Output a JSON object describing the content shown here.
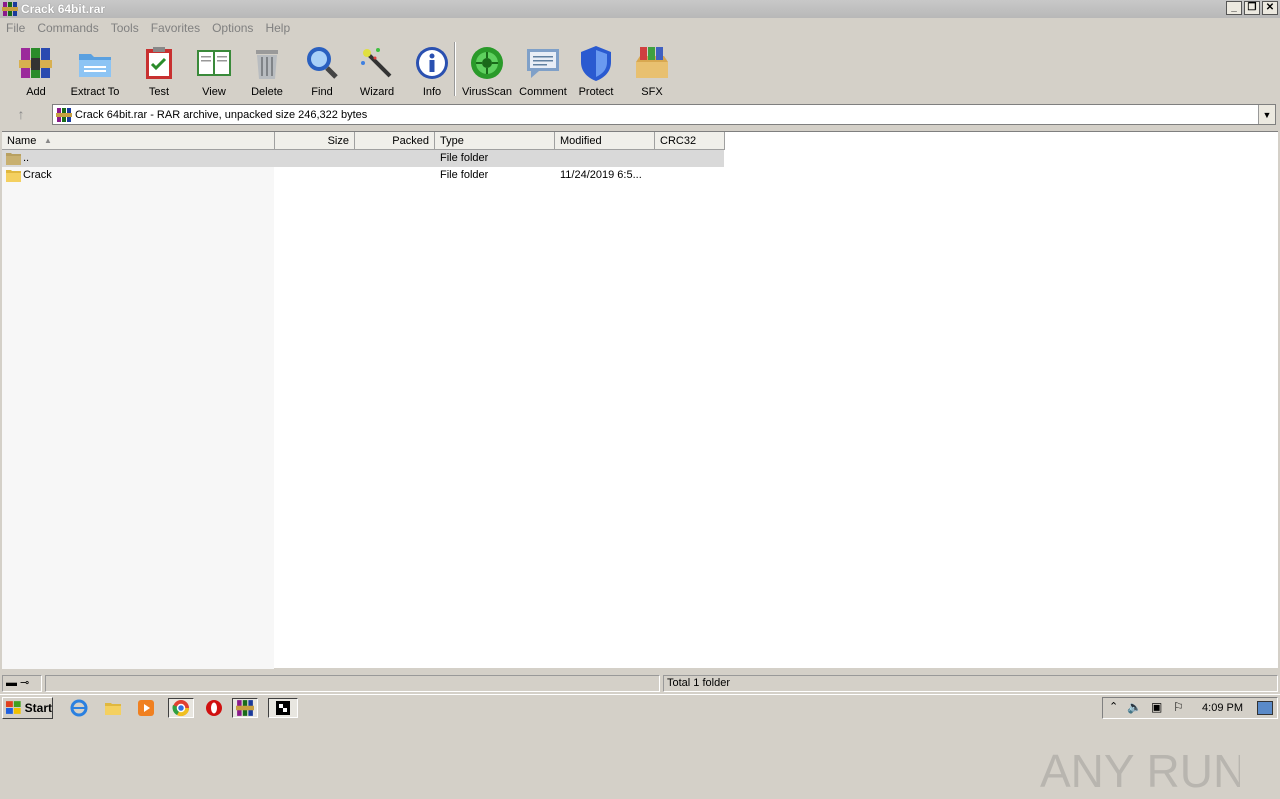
{
  "window": {
    "title": "Crack 64bit.rar",
    "buttons": {
      "minimize": "_",
      "restore": "❐",
      "close": "✕"
    }
  },
  "menu": [
    "File",
    "Commands",
    "Tools",
    "Favorites",
    "Options",
    "Help"
  ],
  "toolbar": {
    "buttons": [
      {
        "label": "Add",
        "icon": "add-archive-icon"
      },
      {
        "label": "Extract To",
        "icon": "extract-folder-icon"
      },
      {
        "label": "Test",
        "icon": "test-clipboard-icon"
      },
      {
        "label": "View",
        "icon": "view-book-icon"
      },
      {
        "label": "Delete",
        "icon": "trash-icon"
      },
      {
        "label": "Find",
        "icon": "magnifier-icon"
      },
      {
        "label": "Wizard",
        "icon": "magic-wand-icon"
      },
      {
        "label": "Info",
        "icon": "info-icon"
      },
      {
        "label": "VirusScan",
        "icon": "virus-scan-icon"
      },
      {
        "label": "Comment",
        "icon": "comment-icon"
      },
      {
        "label": "Protect",
        "icon": "shield-icon"
      },
      {
        "label": "SFX",
        "icon": "sfx-box-icon"
      }
    ]
  },
  "address": {
    "text": "Crack 64bit.rar - RAR archive, unpacked size 246,322 bytes"
  },
  "columns": [
    "Name",
    "Size",
    "Packed",
    "Type",
    "Modified",
    "CRC32"
  ],
  "rows": [
    {
      "name": "..",
      "size": "",
      "packed": "",
      "type": "File folder",
      "modified": "",
      "crc": ""
    },
    {
      "name": "Crack",
      "size": "",
      "packed": "",
      "type": "File folder",
      "modified": "11/24/2019 6:5...",
      "crc": ""
    }
  ],
  "status": {
    "right": "Total 1 folder"
  },
  "taskbar": {
    "start": "Start",
    "clock": "4:09 PM"
  },
  "watermark": "ANY RUN"
}
